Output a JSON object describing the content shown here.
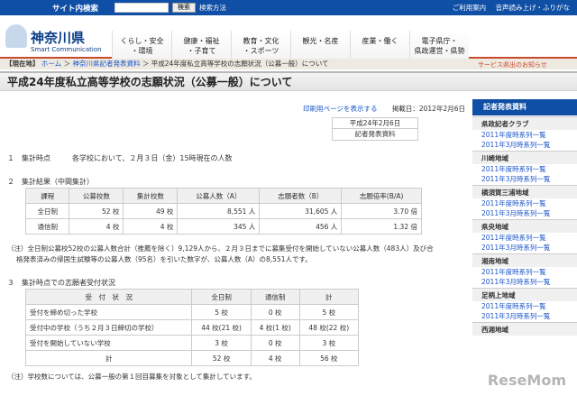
{
  "topbar": {
    "search_label": "サイト内検索",
    "search_button": "検索",
    "search_method": "検索方法",
    "links": [
      "ご利用案内",
      "音声読み上げ・ふりがな"
    ]
  },
  "header": {
    "site_name": "神奈川県",
    "site_sub": "Smart Communication",
    "nav": [
      "くらし・安全\n・環境",
      "健康・福祉\n・子育て",
      "教育・文化\n・スポーツ",
      "観光・名産",
      "産業・働く",
      "電子県庁・\n県政運営・県勢"
    ]
  },
  "breadcrumb": {
    "tag": "【現在地】",
    "home": "ホーム",
    "sep": "＞",
    "section": "神奈川県記者発表資料",
    "current": "平成24年度私立高等学校の志願状況（公募一般）について"
  },
  "nav_badge": "サービス県出のお知らせ",
  "title": "平成24年度私立高等学校の志願状況（公募一般）について",
  "print": {
    "link": "印刷用ページを表示する",
    "date": "掲載日：2012年2月6日"
  },
  "notice": [
    "平成24年2月6日",
    "記者発表資料"
  ],
  "section1": "１　集計時点　　　各学校において、２月３日（金）15時現在の人数",
  "section2": "２　集計結果（中間集計）",
  "table1": {
    "headers": [
      "課程",
      "公募校数",
      "集計校数",
      "公募人数（A）",
      "志願者数（B）",
      "志願倍率(B/A)"
    ],
    "rows": [
      [
        "全日制",
        "52 校",
        "49 校",
        "8,551 人",
        "31,605 人",
        "3.70 倍"
      ],
      [
        "通信制",
        "4 校",
        "4 校",
        "345 人",
        "456 人",
        "1.32 倍"
      ]
    ]
  },
  "note1": "（注）全日制公募校52校の公募人数合計（推薦を除く）9,129人から、２月３日までに募集受付を開始していない公募人数（483人）及び合",
  "note1b": "格発表済みの帰国生試験等の公募人数（95名）を引いた数字が、公募人数（A）の8,551人です。",
  "section3": "３　集計時点での志願者受付状況",
  "table2": {
    "headers": [
      "受　付　状　況",
      "全日制",
      "通信制",
      "計"
    ],
    "rows": [
      [
        "受付を締め切った学校",
        "5 校",
        "0 校",
        "5 校"
      ],
      [
        "受付中の学校（うち２月３日締切の学校）",
        "44 校(21 校)",
        "4 校(1 校)",
        "48 校(22 校)"
      ],
      [
        "受付を開始していない学校",
        "3 校",
        "0 校",
        "3 校"
      ],
      [
        "計",
        "52 校",
        "4 校",
        "56 校"
      ]
    ]
  },
  "note2": "（注）学校数については、公募一般の第１回目募集を対象として集計しています。",
  "sidebar": {
    "head": "記者発表資料",
    "groups": [
      {
        "region": "県政記者クラブ",
        "links": [
          "2011年度時系列一覧",
          "2011年3月時系列一覧"
        ]
      },
      {
        "region": "川崎地域",
        "links": [
          "2011年度時系列一覧",
          "2011年3月時系列一覧"
        ]
      },
      {
        "region": "横須賀三浦地域",
        "links": [
          "2011年度時系列一覧",
          "2011年3月時系列一覧"
        ]
      },
      {
        "region": "県央地域",
        "links": [
          "2011年度時系列一覧",
          "2011年3月時系列一覧"
        ]
      },
      {
        "region": "湘南地域",
        "links": [
          "2011年度時系列一覧",
          "2011年3月時系列一覧"
        ]
      },
      {
        "region": "足柄上地域",
        "links": [
          "2011年度時系列一覧",
          "2011年3月時系列一覧"
        ]
      },
      {
        "region": "西湘地域",
        "links": []
      }
    ]
  },
  "watermark": "ReseMom"
}
